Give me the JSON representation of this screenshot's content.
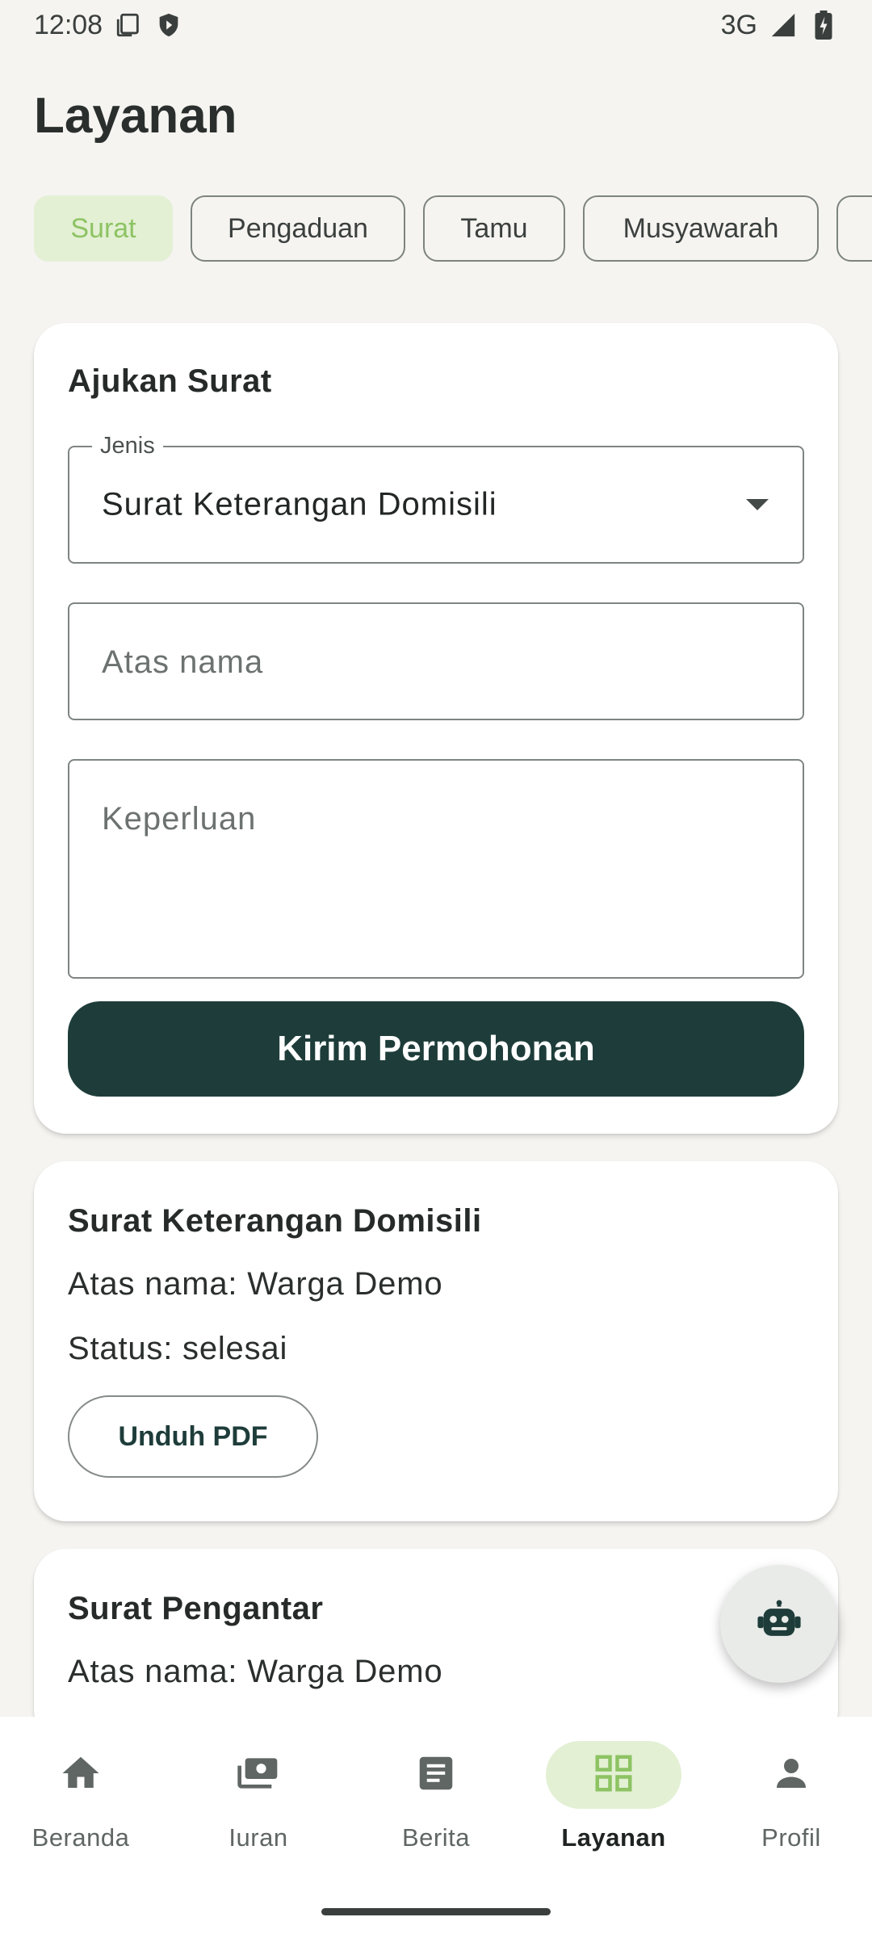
{
  "status_bar": {
    "time": "12:08",
    "network": "3G"
  },
  "page": {
    "title": "Layanan"
  },
  "tabs": [
    {
      "label": "Surat",
      "active": true
    },
    {
      "label": "Pengaduan",
      "active": false
    },
    {
      "label": "Tamu",
      "active": false
    },
    {
      "label": "Musyawarah",
      "active": false
    }
  ],
  "form": {
    "title": "Ajukan Surat",
    "jenis_label": "Jenis",
    "jenis_value": "Surat Keterangan Domisili",
    "atas_nama_placeholder": "Atas nama",
    "keperluan_placeholder": "Keperluan",
    "submit_label": "Kirim Permohonan"
  },
  "requests": [
    {
      "title": "Surat Keterangan Domisili",
      "atas_nama": "Atas nama: Warga Demo",
      "status": "Status: selesai",
      "download_label": "Unduh PDF"
    },
    {
      "title": "Surat Pengantar",
      "atas_nama": "Atas nama: Warga Demo"
    }
  ],
  "bottom_nav": [
    {
      "label": "Beranda",
      "icon": "home-icon",
      "active": false
    },
    {
      "label": "Iuran",
      "icon": "payments-icon",
      "active": false
    },
    {
      "label": "Berita",
      "icon": "article-icon",
      "active": false
    },
    {
      "label": "Layanan",
      "icon": "grid-icon",
      "active": true
    },
    {
      "label": "Profil",
      "icon": "person-icon",
      "active": false
    }
  ],
  "colors": {
    "primary": "#1e3d3a",
    "accent": "#8dc363",
    "accent_bg": "#e3f0d4",
    "background": "#f5f4f1"
  }
}
